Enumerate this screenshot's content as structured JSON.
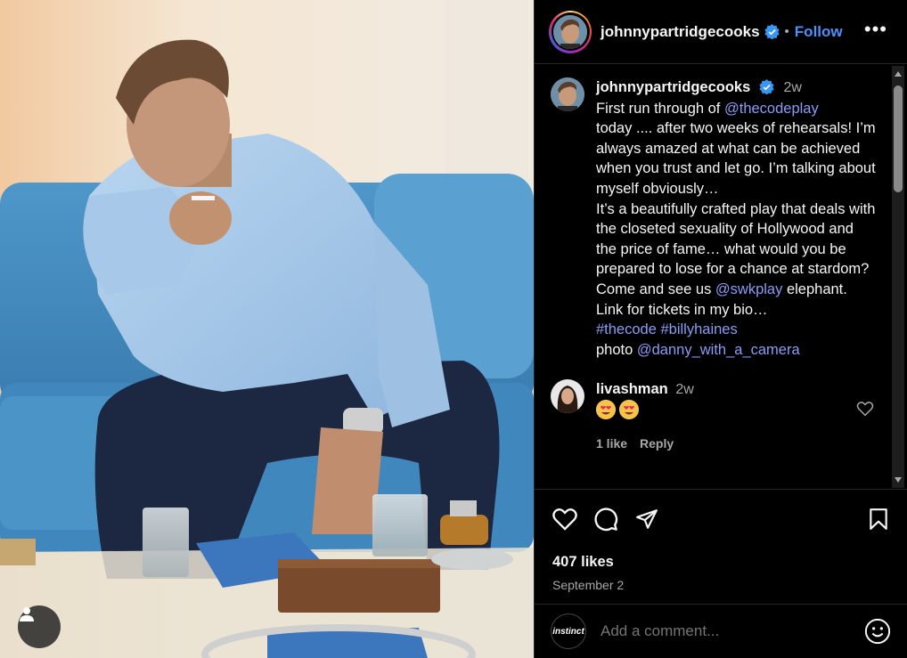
{
  "post": {
    "author": "johnnypartridgecooks",
    "follow_label": "Follow",
    "separator": "•",
    "more_label": "•••"
  },
  "caption": {
    "username": "johnnypartridgecooks",
    "time": "2w",
    "line1_pre": "First run through of ",
    "mention1": "@thecodeplay",
    "text2": "today .... after two weeks of rehearsals! I’m always amazed at what can be achieved when you trust and let go. I’m talking about myself obviously…",
    "text3": "It’s a beautifully crafted play that deals with the closeted sexuality of Hollywood and the price of fame… what would you be prepared to lose for a chance at stardom?",
    "text4_pre": "Come and see us ",
    "mention2": "@swkplay",
    "text4_post": " elephant.",
    "text5": "Link for tickets in my bio…",
    "tag1": "#thecode",
    "tag2": "#billyhaines",
    "photo_pre": "photo ",
    "mention3": "@danny_with_a_camera"
  },
  "comments": [
    {
      "username": "livashman",
      "time": "2w",
      "likes": "1 like",
      "reply": "Reply"
    }
  ],
  "engagement": {
    "likes": "407 likes",
    "date": "September 2"
  },
  "comment_box": {
    "avatar_text": "instinct",
    "placeholder": "Add a comment..."
  },
  "colors": {
    "link": "#8c9cf5",
    "follow": "#4f8ff7",
    "verified": "#3897f0"
  }
}
